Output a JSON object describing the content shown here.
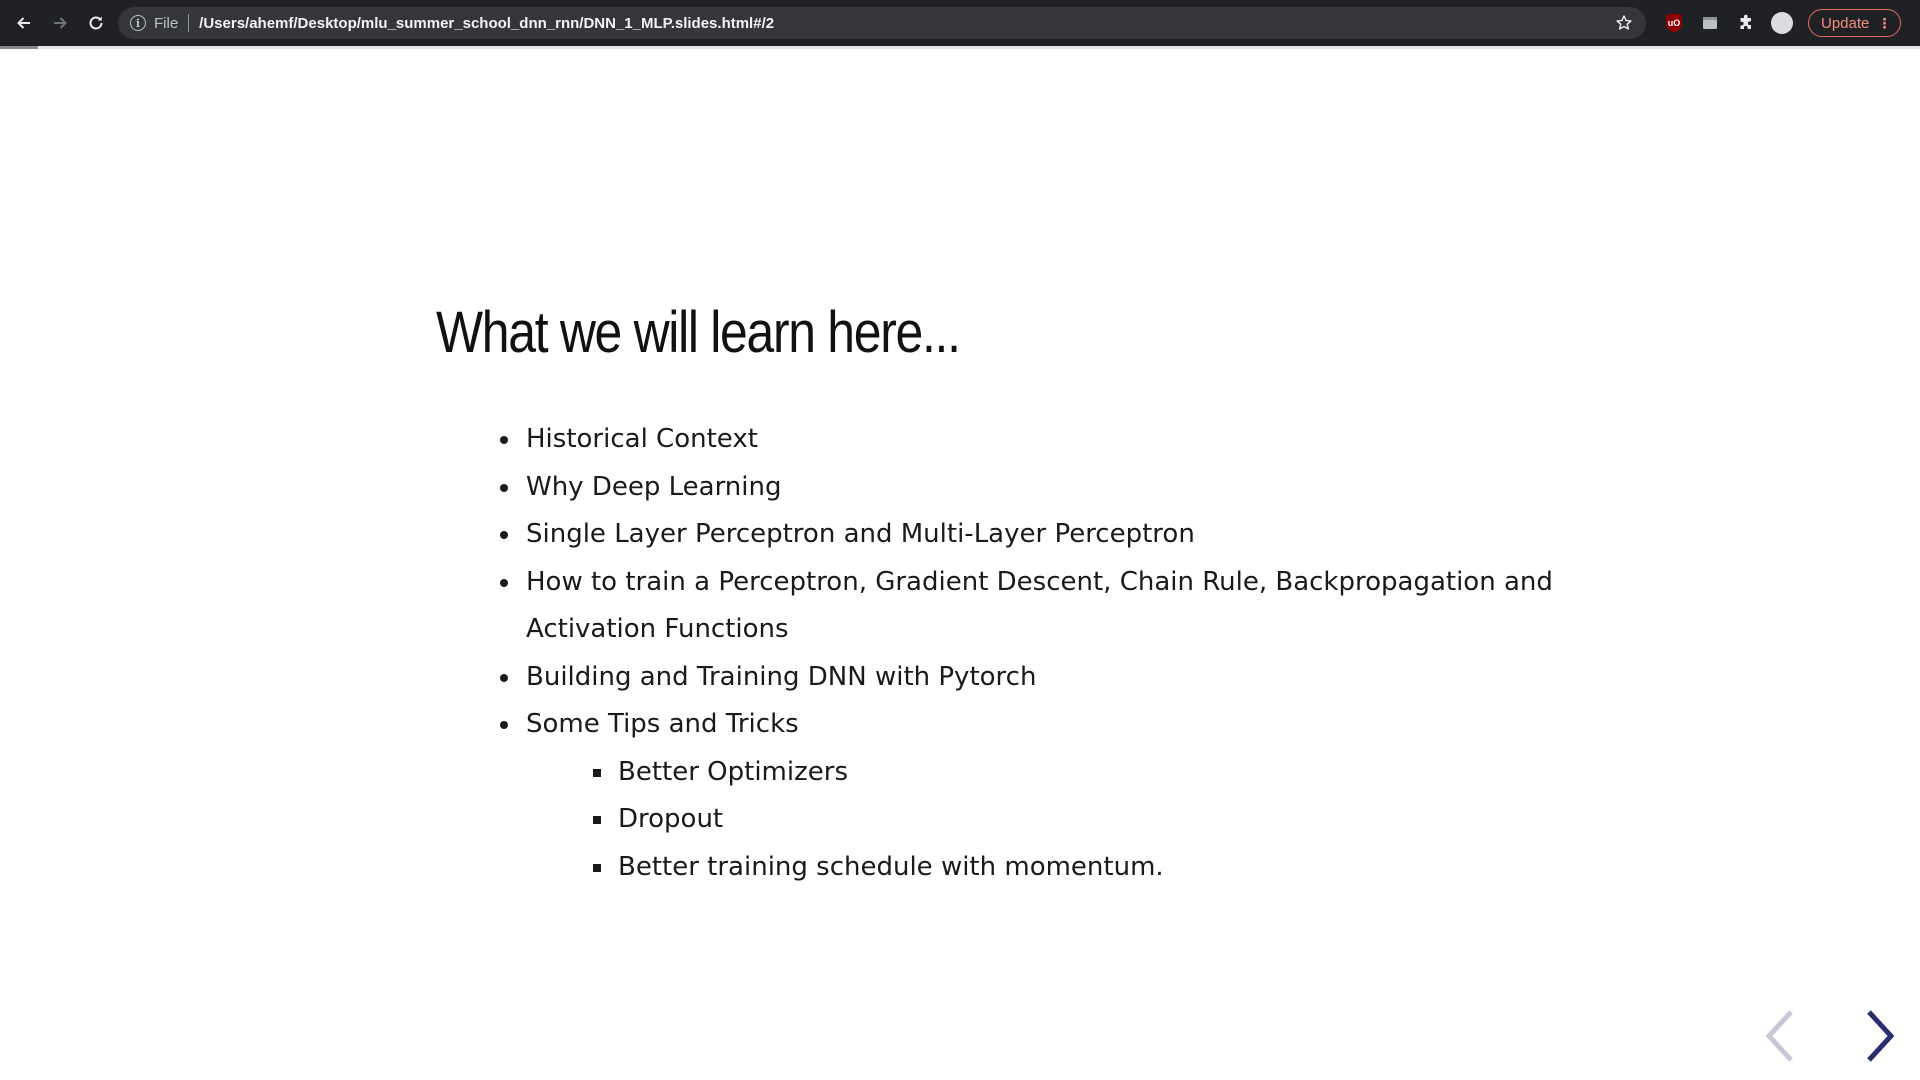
{
  "browser": {
    "scheme_label": "File",
    "url": "/Users/ahemf/Desktop/mlu_summer_school_dnn_rnn/DNN_1_MLP.slides.html#/2",
    "update_label": "Update",
    "ublock_label": "uO",
    "icons": {
      "back": "arrow-left-icon",
      "forward": "arrow-right-icon",
      "reload": "reload-icon",
      "info": "info-icon",
      "star": "star-icon",
      "extensions": "puzzle-icon",
      "menu": "kebab-menu-icon"
    },
    "colors": {
      "toolbar": "#202124",
      "omnibox": "#35363a",
      "update_accent": "#f28b82"
    }
  },
  "slide": {
    "title": "What we will learn here...",
    "bullets": [
      "Historical Context",
      "Why Deep Learning",
      "Single Layer Perceptron and Multi-Layer Perceptron",
      "How to train a Perceptron, Gradient Descent, Chain Rule, Backpropagation and Activation Functions",
      "Building and Training DNN with Pytorch",
      "Some Tips and Tricks"
    ],
    "sub_bullets": [
      "Better Optimizers",
      "Dropout",
      "Better training schedule with momentum."
    ],
    "progress_fraction": 0.02,
    "nav_color": "#2a2f6e"
  }
}
